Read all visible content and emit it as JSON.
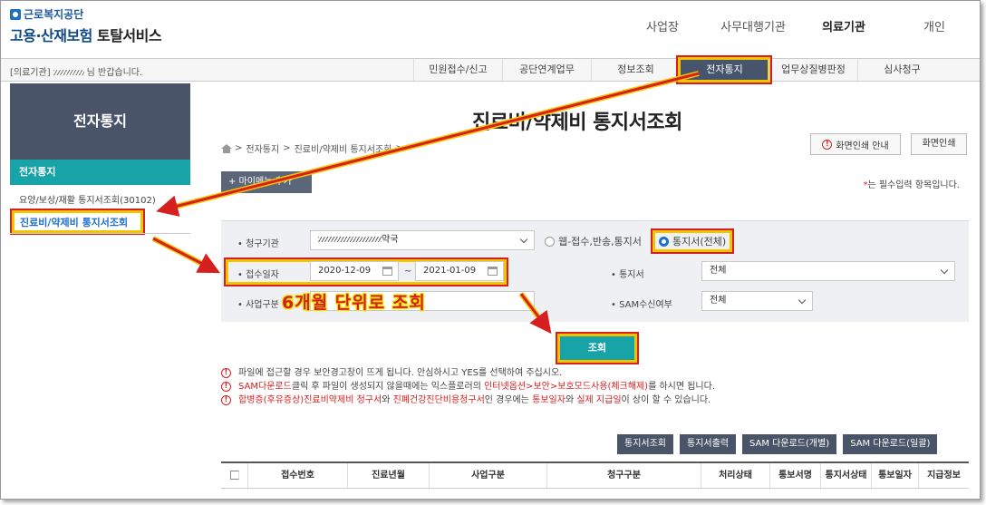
{
  "header": {
    "org": "근로복지공단",
    "service_main": "고용·산재보험",
    "service_suffix": "토탈서비스",
    "top_nav": [
      "사업장",
      "사무대행기관",
      "의료기관",
      "개인"
    ],
    "top_nav_active": "의료기관"
  },
  "subbar": {
    "user_type": "[의료기관]",
    "welcome_suffix": "님 반갑습니다.",
    "menu": [
      "민원접수/신고",
      "공단연계업무",
      "정보조회",
      "전자통지",
      "업무상질병판정",
      "심사청구"
    ],
    "menu_active": "전자통지"
  },
  "sidebar": {
    "title": "전자통지",
    "section": "전자통지",
    "items": [
      "요양/보상/재활 통지서조회(30102)",
      "진료비/약제비 통지서조회"
    ],
    "active_item": "진료비/약제비 통지서조회"
  },
  "page": {
    "title": "진료비/약제비 통지서조회",
    "breadcrumb": [
      "전자통지",
      "진료비/약제비 통지서조회"
    ],
    "guide_button": "화면인쇄 안내",
    "print_button": "화면인쇄",
    "add_menu_button": "+ 마이메뉴 추가",
    "required_note": "는 필수입력 항목입니다."
  },
  "form": {
    "agency_label": "• 청구기관",
    "agency_value_suffix": "약국",
    "radio_web": "웹-접수,반송,통지서",
    "radio_all": "통지서(전체)",
    "date_label": "• 접수일자",
    "date_from": "2020-12-09",
    "date_sep": "~",
    "date_to": "2021-01-09",
    "notice_label": "• 통지서",
    "notice_value": "전체",
    "biz_label": "• 사업구분",
    "sam_label": "• SAM수신여부",
    "sam_value": "전체",
    "search_button": "조회"
  },
  "annotation": "6개월 단위로 조회",
  "notes": {
    "n1": "파일에 접근할 경우 보안경고창이 뜨게 됩니다. 안심하시고 YES를 선택하여 주십시오.",
    "n2a": "SAM다운로드",
    "n2b": "클릭 후 파일이 생성되지 않을때에는 익스플로러의 ",
    "n2c": "인터넷옵션>보안>보호모드사용(체크해제)",
    "n2d": "를 하시면 됩니다.",
    "n3a": "합병증(후유증상)진료비약제비 청구서",
    "n3b": "와 ",
    "n3c": "진폐건강진단비용청구서",
    "n3d": "인 경우에는 ",
    "n3e": "통보일자",
    "n3f": "와 ",
    "n3g": "실제 지급일",
    "n3h": "이 상이 할 수 있습니다."
  },
  "actions": [
    "통지서조회",
    "통지서출력",
    "SAM 다운로드(개별)",
    "SAM 다운로드(일괄)"
  ],
  "table": {
    "columns": [
      "",
      "접수번호",
      "진료년월",
      "사업구분",
      "청구구분",
      "처리상태",
      "통보서명",
      "통지서상태",
      "통보일자",
      "지급정보"
    ]
  },
  "colors": {
    "accent_teal": "#17a3a8",
    "sidebar_dark": "#4a5468",
    "highlight_red": "#d62020",
    "highlight_yellow": "#f3c500"
  }
}
